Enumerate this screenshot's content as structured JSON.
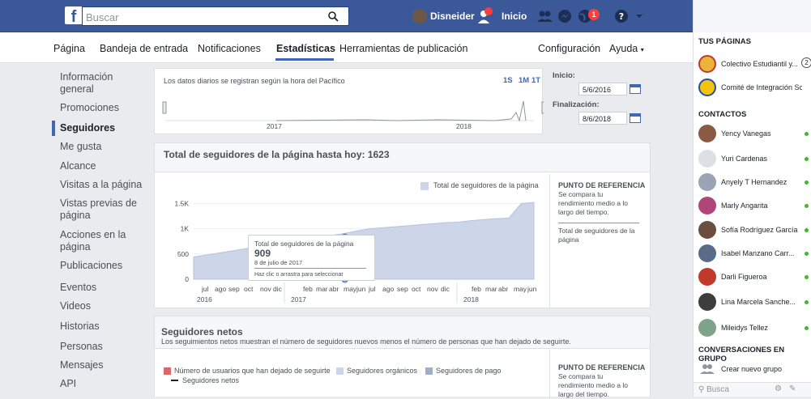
{
  "topbar": {
    "search_placeholder": "Buscar",
    "user_name": "Disneider",
    "home_label": "Inicio",
    "notifications_count": "1"
  },
  "pagenav": {
    "items": [
      "Página",
      "Bandeja de entrada",
      "Notificaciones",
      "Estadísticas",
      "Herramientas de publicación"
    ],
    "config": "Configuración",
    "help": "Ayuda"
  },
  "leftnav": {
    "items": [
      "Información general",
      "Promociones",
      "Seguidores",
      "Me gusta",
      "Alcance",
      "Visitas a la página",
      "Vistas previas de página",
      "Acciones en la página",
      "Publicaciones",
      "Eventos",
      "Videos",
      "Historias",
      "Personas",
      "Mensajes",
      "API"
    ]
  },
  "range": {
    "note": "Los datos diarios se registran según la hora del Pacífico",
    "periods": [
      "1S",
      "1M",
      "1T"
    ],
    "start_label": "Inicio:",
    "start_date": "5/6/2016",
    "end_label": "Finalización:",
    "end_date": "8/6/2018",
    "year_labels": [
      "2017",
      "2018"
    ]
  },
  "followers": {
    "title": "Total de seguidores de la página hasta hoy: 1623",
    "legend": "Total de seguidores de la página",
    "reference_title": "PUNTO DE REFERENCIA",
    "reference_text": "Se compara tu rendimiento medio a lo largo del tiempo.",
    "reference_item": "Total de seguidores de la página",
    "tooltip": {
      "label": "Total de seguidores de la página",
      "value": "909",
      "date": "8 de julio de 2017",
      "hint": "Haz clic o arrastra para seleccionar"
    }
  },
  "chart_data": {
    "type": "area",
    "title": "Total de seguidores de la página hasta hoy: 1623",
    "series": [
      {
        "name": "Total de seguidores de la página",
        "values": [
          440,
          480,
          520,
          560,
          600,
          640,
          680,
          720,
          760,
          800,
          840,
          870,
          909,
          960,
          1000,
          1020,
          1040,
          1060,
          1080,
          1100,
          1120,
          1130,
          1160,
          1180,
          1200,
          1210,
          1500,
          1520
        ]
      }
    ],
    "x": [
      "jul",
      "ago",
      "sep",
      "oct",
      "nov",
      "dic",
      "",
      "feb",
      "mar",
      "abr",
      "may",
      "jun",
      "jul",
      "ago",
      "sep",
      "oct",
      "nov",
      "dic",
      "",
      "feb",
      "mar",
      "abr",
      "may",
      "jun",
      "",
      "",
      "",
      ""
    ],
    "x_tick_labels": [
      "jul",
      "ago",
      "sep",
      "oct",
      "nov",
      "dic",
      "feb",
      "mar",
      "abr",
      "may",
      "jun",
      "jul",
      "ago",
      "sep",
      "oct",
      "nov",
      "dic",
      "feb",
      "mar",
      "abr",
      "may",
      "jun"
    ],
    "x_year_labels": [
      "2016",
      "2017",
      "2018"
    ],
    "y_ticks": [
      "0",
      "500",
      "1K",
      "1.5K"
    ],
    "ylim": [
      0,
      1700
    ],
    "grid": true,
    "legend": "top-right",
    "color": "#cdd6e8"
  },
  "net": {
    "title": "Seguidores netos",
    "subtitle": "Los seguimientos netos muestran el número de seguidores nuevos menos el número de personas que han dejado de seguirte.",
    "legend": [
      "Número de usuarios que han dejado de seguirte",
      "Seguidores orgánicos",
      "Seguidores de pago",
      "Seguidores netos"
    ],
    "reference_title": "PUNTO DE REFERENCIA",
    "reference_text": "Se compara tu rendimiento medio a lo largo del tiempo."
  },
  "sidebar": {
    "pages_title": "TUS PÁGINAS",
    "pages": [
      "Colectivo Estudiantil y...",
      "Comité de Integración So..."
    ],
    "pages_count": "2",
    "contacts_title": "CONTACTOS",
    "contacts": [
      "Yency Vanegas",
      "Yuri Cardenas",
      "Anyely T Hernandez",
      "Marly Angarita",
      "Sofía Rodríguez García",
      "Isabel Manzano Carr...",
      "Darli Figueroa",
      "Lina Marcela Sanche...",
      "Mileidys Tellez"
    ],
    "groups_title": "CONVERSACIONES EN GRUPO",
    "new_group": "Crear nuevo grupo",
    "search": "Busca"
  },
  "colors": {
    "brand": "#3b5998",
    "accent": "#4267b2",
    "area": "#cdd6e8",
    "unfollow": "#d9686a",
    "organic": "#cdd6e8",
    "paid": "#a0aec8"
  }
}
